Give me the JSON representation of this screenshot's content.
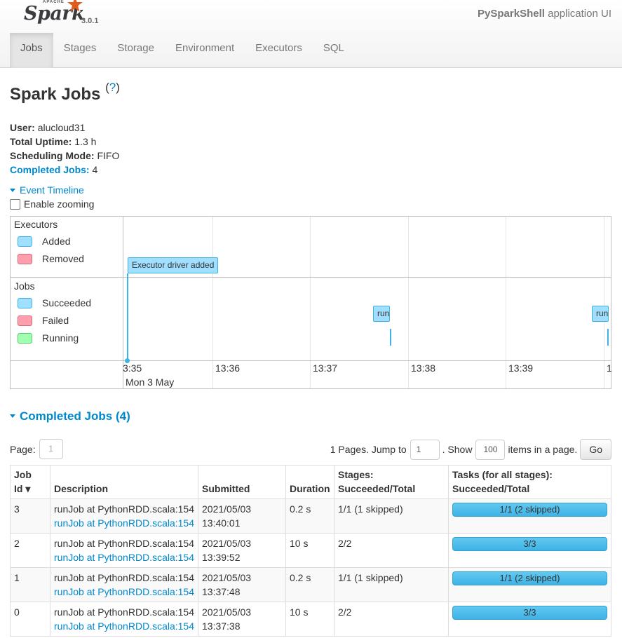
{
  "brand": {
    "apache": "APACHE",
    "name": "Spark",
    "version": "3.0.1"
  },
  "app": {
    "name": "PySparkShell",
    "suffix": " application UI"
  },
  "tabs": [
    {
      "label": "Jobs",
      "active": true
    },
    {
      "label": "Stages"
    },
    {
      "label": "Storage"
    },
    {
      "label": "Environment"
    },
    {
      "label": "Executors"
    },
    {
      "label": "SQL"
    }
  ],
  "page": {
    "title": "Spark Jobs",
    "help_open": "(",
    "help_q": "?",
    "help_close": ")"
  },
  "summary": {
    "user_label": "User:",
    "user": "alucloud31",
    "uptime_label": "Total Uptime:",
    "uptime": "1.3 h",
    "mode_label": "Scheduling Mode:",
    "mode": "FIFO",
    "completed_label": "Completed Jobs:",
    "completed": "4"
  },
  "timeline": {
    "toggle_label": "Event Timeline",
    "zoom_label": "Enable zooming",
    "executors_title": "Executors",
    "executor_legend": [
      "Added",
      "Removed"
    ],
    "jobs_title": "Jobs",
    "job_legend": [
      "Succeeded",
      "Failed",
      "Running"
    ],
    "executor_event": "Executor driver added",
    "job_events": [
      "run",
      "run"
    ],
    "ticks": [
      "3:35",
      "13:36",
      "13:37",
      "13:38",
      "13:39",
      "1"
    ],
    "date_label": "Mon 3 May"
  },
  "completed_jobs": {
    "heading": "Completed Jobs (4)",
    "page_label": "Page:",
    "page_placeholder": "1",
    "pages_text": "1 Pages. Jump to",
    "jump_value": "1",
    "show_text": ". Show",
    "show_value": "100",
    "items_text": "items in a page.",
    "go_label": "Go",
    "columns": [
      "Job Id ▾",
      "Description",
      "Submitted",
      "Duration",
      "Stages: Succeeded/Total",
      "Tasks (for all stages): Succeeded/Total"
    ],
    "col_job_id": "Job",
    "col_job_id2": "Id ▾",
    "col_stages1": "Stages:",
    "col_stages2": "Succeeded/Total",
    "col_tasks1": "Tasks (for all stages):",
    "col_tasks2": "Succeeded/Total",
    "rows": [
      {
        "id": "3",
        "desc": "runJob at PythonRDD.scala:154",
        "link": "runJob at PythonRDD.scala:154",
        "date": "2021/05/03",
        "time": "13:40:01",
        "duration": "0.2 s",
        "stages": "1/1 (1 skipped)",
        "tasks": "1/1 (2 skipped)",
        "progress": 1.0
      },
      {
        "id": "2",
        "desc": "runJob at PythonRDD.scala:154",
        "link": "runJob at PythonRDD.scala:154",
        "date": "2021/05/03",
        "time": "13:39:52",
        "duration": "10 s",
        "stages": "2/2",
        "tasks": "3/3",
        "progress": 1.0
      },
      {
        "id": "1",
        "desc": "runJob at PythonRDD.scala:154",
        "link": "runJob at PythonRDD.scala:154",
        "date": "2021/05/03",
        "time": "13:37:48",
        "duration": "0.2 s",
        "stages": "1/1 (1 skipped)",
        "tasks": "1/1 (2 skipped)",
        "progress": 1.0
      },
      {
        "id": "0",
        "desc": "runJob at PythonRDD.scala:154",
        "link": "runJob at PythonRDD.scala:154",
        "date": "2021/05/03",
        "time": "13:37:38",
        "duration": "10 s",
        "stages": "2/2",
        "tasks": "3/3",
        "progress": 1.0
      }
    ]
  },
  "colors": {
    "link": "#0088cc",
    "accent_orange": "#e25a1c",
    "bar_blue": "#3eb3e6"
  }
}
